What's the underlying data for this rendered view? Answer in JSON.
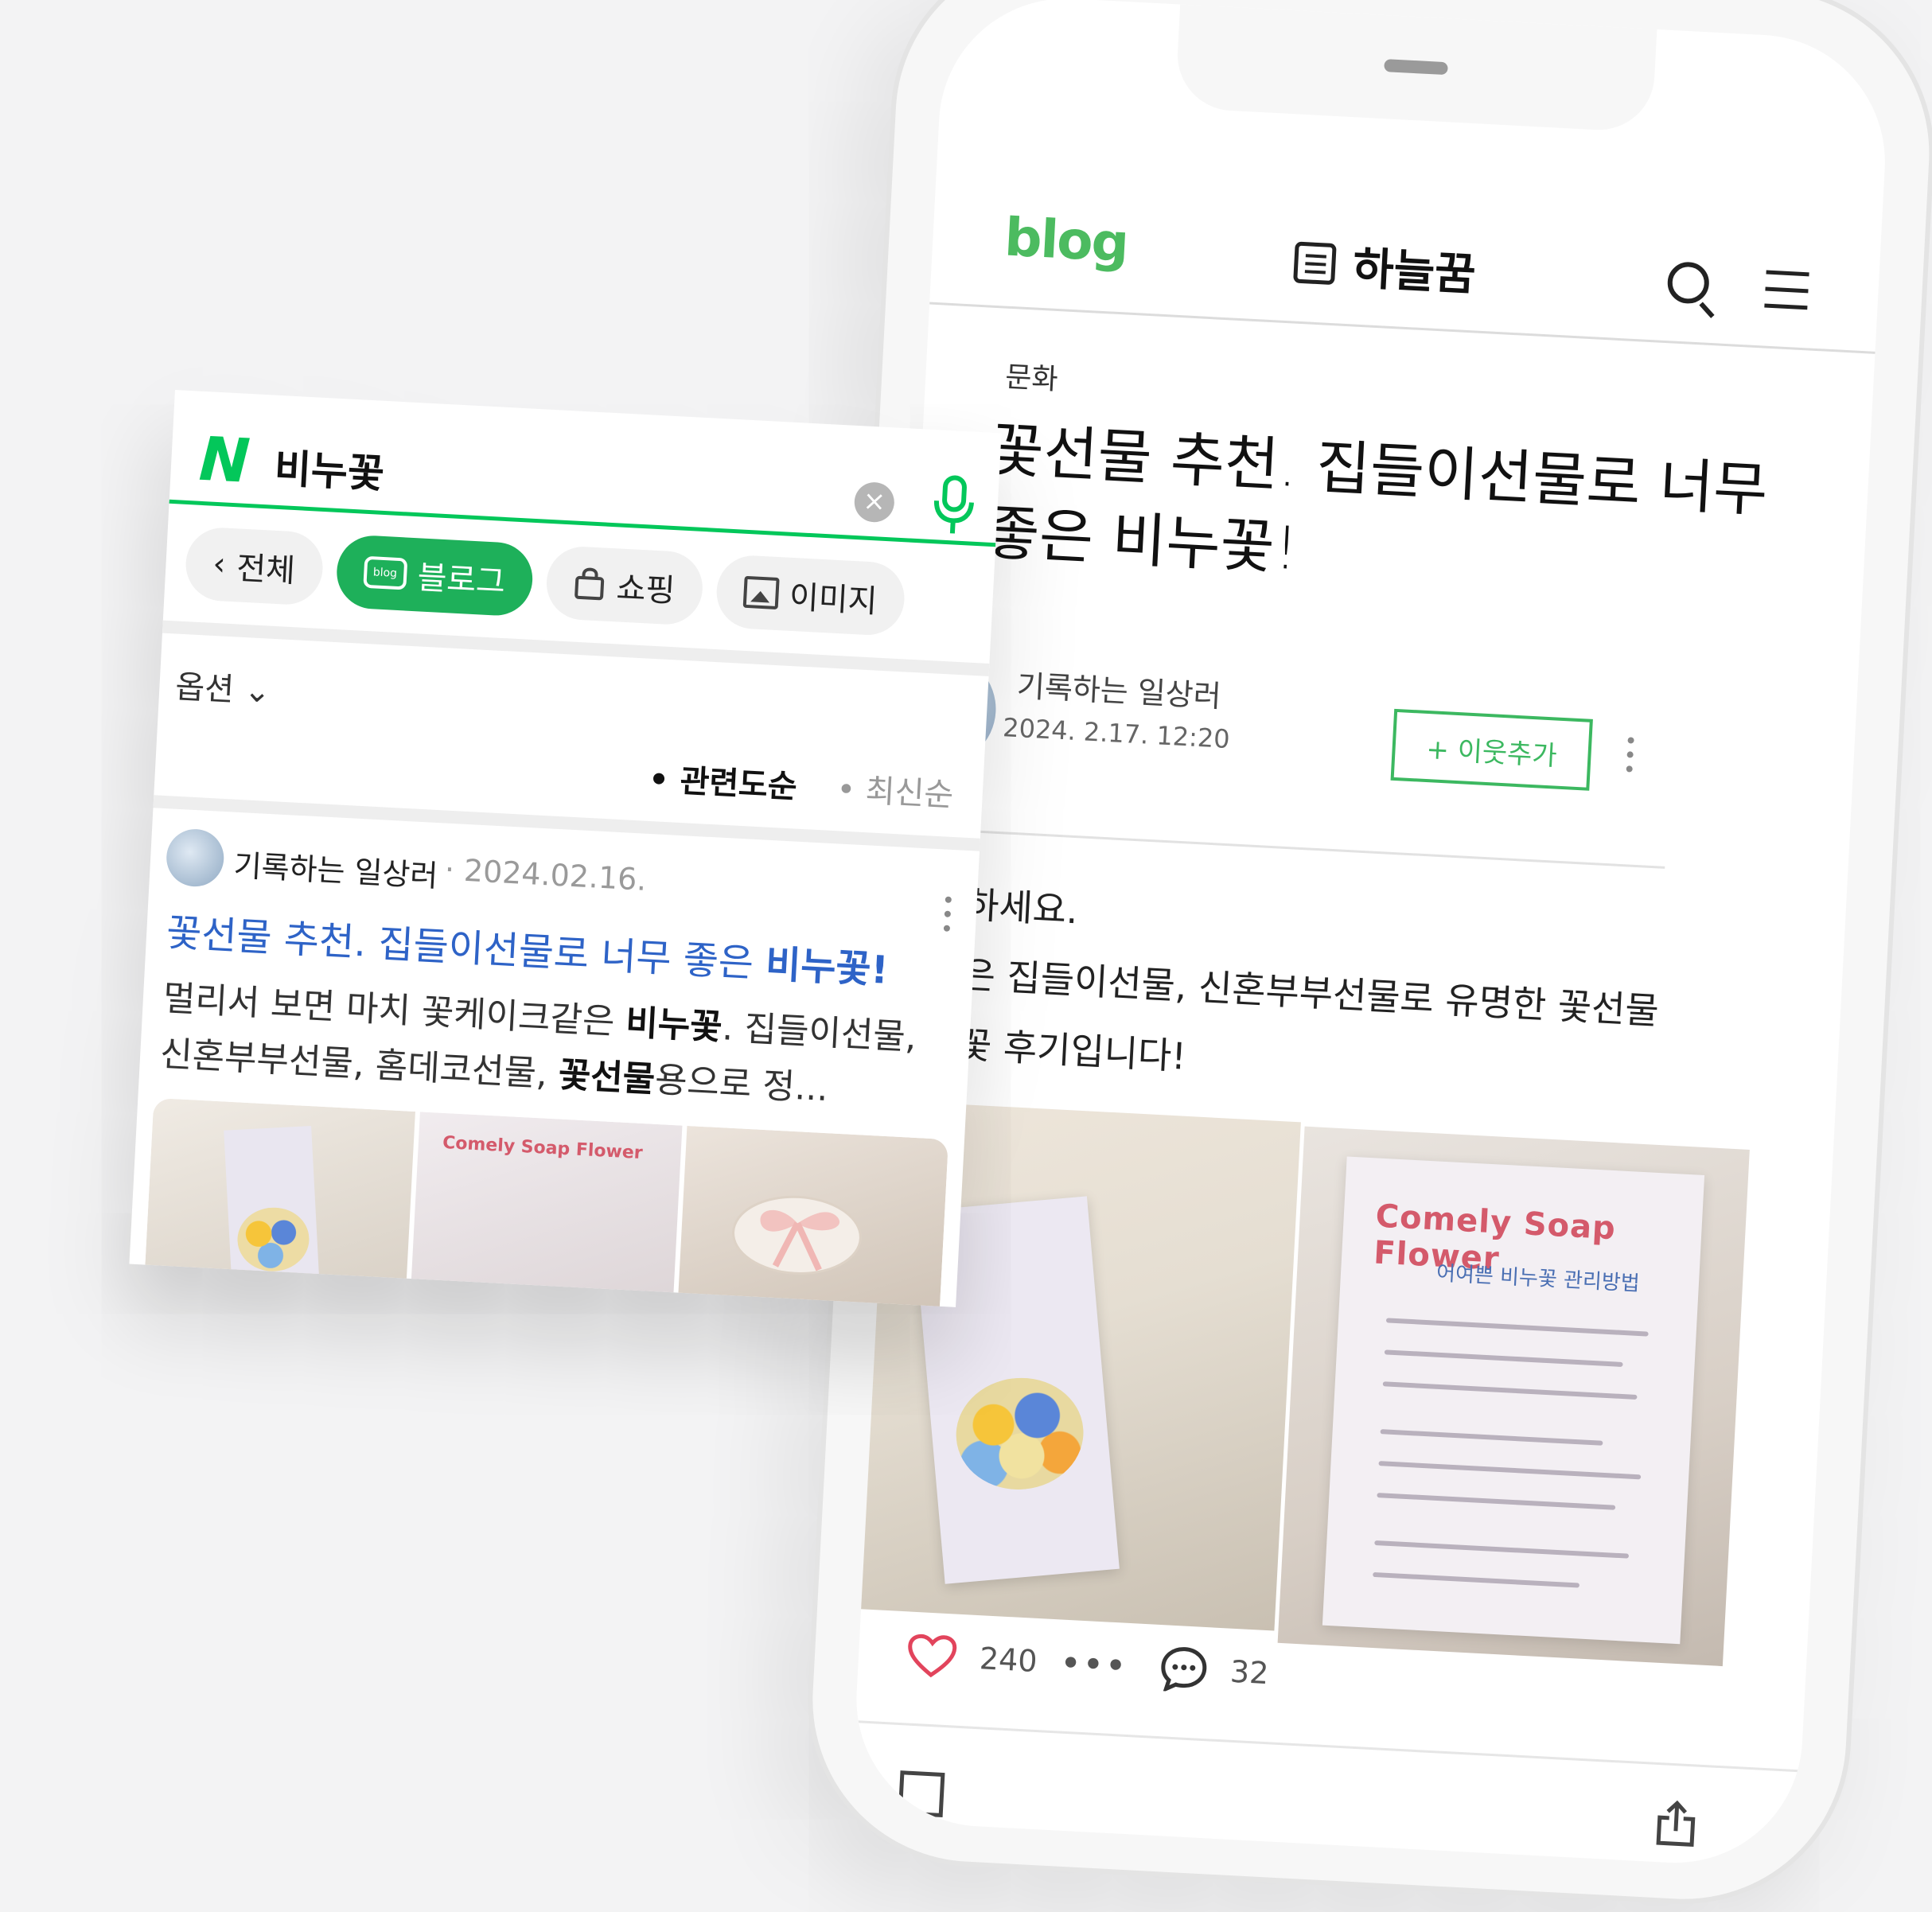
{
  "phone": {
    "blog_logo": "blog",
    "blog_name": "하늘꿈",
    "category": "문화",
    "post_title": "꽃선물 추천. 집들이선물로 너무 좋은 비누꽃!",
    "author": "기록하는 일상러",
    "date": "2024. 2.17. 12:20",
    "follow_label": "+ 이웃추가",
    "body_lines": [
      "안녕하세요.",
      "오늘은 집들이선물, 신혼부부선물로 유명한 꽃선물",
      "비누꽃 후기입니다!"
    ],
    "photo_card_brand": "Comely Soap Flower",
    "photo_card_subtitle": "어여쁜 비누꽃 관리방법",
    "like_count": "240",
    "more_label": "•••",
    "comment_count": "32"
  },
  "search": {
    "logo": "N",
    "query": "비누꽃",
    "clear_label": "×",
    "tabs": [
      {
        "label": "전체",
        "icon": "chevron-left-icon"
      },
      {
        "label": "블로그",
        "icon": "blog-icon"
      },
      {
        "label": "쇼핑",
        "icon": "shopping-bag-icon"
      },
      {
        "label": "이미지",
        "icon": "image-icon"
      }
    ],
    "blog_icon_text": "blog",
    "option_label": "옵션",
    "sort_relevance": "• 관련도순",
    "sort_latest": "• 최신순",
    "result": {
      "author": "기록하는 일상러",
      "date": "· 2024.02.16.",
      "title_plain": "꽃선물 추천. 집들이선물로 너무 좋은 ",
      "title_bold": "비누꽃!",
      "desc_1": "멀리서 보면 마치 꽃케이크같은 ",
      "desc_bold_1": "비누꽃",
      "desc_2": ". 집들이선물, 신혼부부선물, 홈데코선물, ",
      "desc_bold_2": "꽃선물",
      "desc_3": "용으로 정..."
    }
  },
  "colors": {
    "naver_green": "#03c75a",
    "blog_green": "#4cbb60",
    "link_blue": "#2e63c7",
    "tab_active": "#1eb05a"
  }
}
